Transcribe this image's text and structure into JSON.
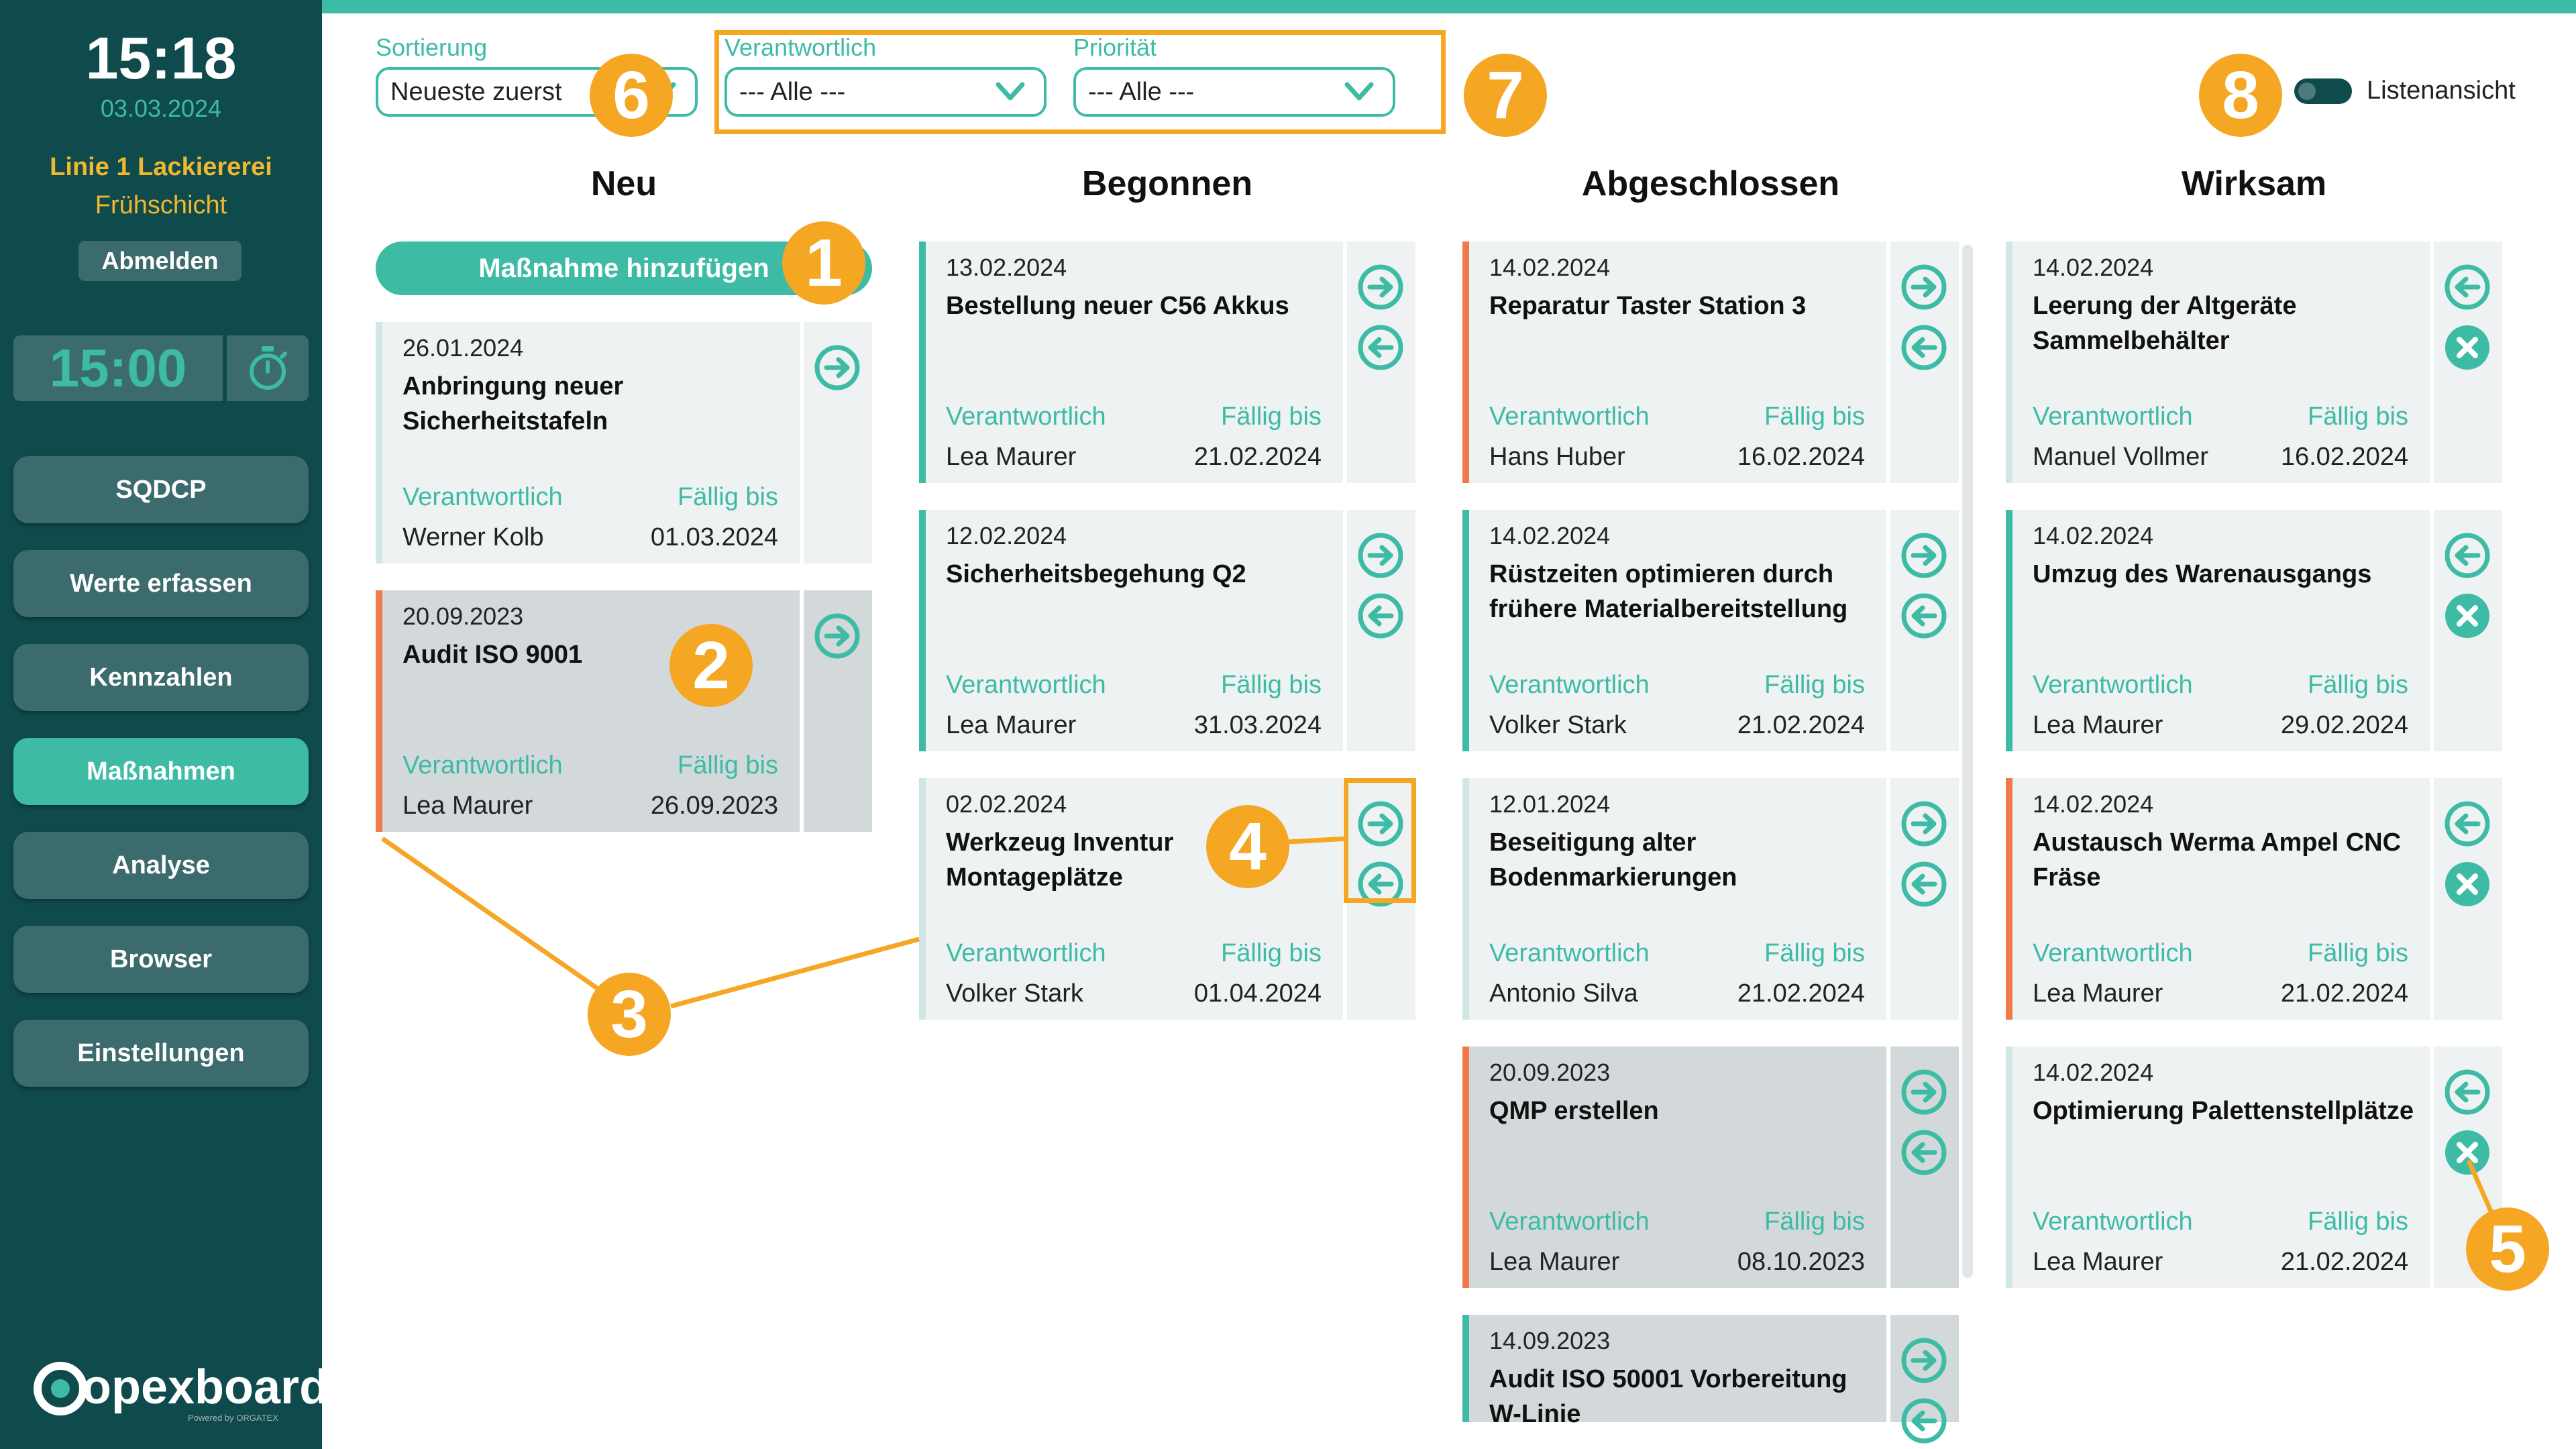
{
  "sidebar": {
    "time": "15:18",
    "date": "03.03.2024",
    "line": "Linie 1 Lackiererei",
    "shift": "Frühschicht",
    "logout_label": "Abmelden",
    "timer": "15:00",
    "nav": [
      "SQDCP",
      "Werte erfassen",
      "Kennzahlen",
      "Maßnahmen",
      "Analyse",
      "Browser",
      "Einstellungen"
    ],
    "active_nav": "Maßnahmen",
    "logo_text": "opexboard",
    "logo_sub": "Powered by ORGATEX"
  },
  "filters": {
    "sort_label": "Sortierung",
    "sort_value": "Neueste zuerst",
    "owner_label": "Verantwortlich",
    "owner_value": "--- Alle ---",
    "prio_label": "Priorität",
    "prio_value": "--- Alle ---",
    "list_view_label": "Listenansicht"
  },
  "columns": {
    "new": "Neu",
    "started": "Begonnen",
    "done": "Abgeschlossen",
    "effective": "Wirksam"
  },
  "add_button": "Maßnahme hinzufügen",
  "labels": {
    "owner": "Verantwortlich",
    "due": "Fällig bis"
  },
  "callouts": [
    "1",
    "2",
    "3",
    "4",
    "5",
    "6",
    "7",
    "8"
  ],
  "cards": {
    "new": [
      {
        "date": "26.01.2024",
        "title": "Anbringung neuer Sicherheitstafeln",
        "owner": "Werner Kolb",
        "due": "01.03.2024",
        "accent": "#cfe8e5"
      },
      {
        "date": "20.09.2023",
        "title": "Audit ISO 9001",
        "owner": "Lea Maurer",
        "due": "26.09.2023",
        "accent": "#f07a4a"
      }
    ],
    "started": [
      {
        "date": "13.02.2024",
        "title": "Bestellung neuer C56 Akkus",
        "owner": "Lea Maurer",
        "due": "21.02.2024",
        "accent": "#3dbba5"
      },
      {
        "date": "12.02.2024",
        "title": "Sicherheitsbegehung Q2",
        "owner": "Lea Maurer",
        "due": "31.03.2024",
        "accent": "#3dbba5"
      },
      {
        "date": "02.02.2024",
        "title": "Werkzeug Inventur Montageplätze",
        "owner": "Volker Stark",
        "due": "01.04.2024",
        "accent": "#cfe8e5"
      }
    ],
    "done": [
      {
        "date": "14.02.2024",
        "title": "Reparatur Taster Station 3",
        "owner": "Hans Huber",
        "due": "16.02.2024",
        "accent": "#f07a4a"
      },
      {
        "date": "14.02.2024",
        "title": "Rüstzeiten optimieren durch frühere Materialbereitstellung",
        "owner": "Volker Stark",
        "due": "21.02.2024",
        "accent": "#3dbba5"
      },
      {
        "date": "12.01.2024",
        "title": "Beseitigung alter Bodenmarkierungen",
        "owner": "Antonio Silva",
        "due": "21.02.2024",
        "accent": "#cfe8e5"
      },
      {
        "date": "20.09.2023",
        "title": "QMP erstellen",
        "owner": "Lea Maurer",
        "due": "08.10.2023",
        "accent": "#f07a4a"
      },
      {
        "date": "14.09.2023",
        "title": "Audit ISO 50001 Vorbereitung W-Linie",
        "owner": "",
        "due": "",
        "accent": "#3dbba5"
      }
    ],
    "effective": [
      {
        "date": "14.02.2024",
        "title": "Leerung der Altgeräte Sammelbehälter",
        "owner": "Manuel Vollmer",
        "due": "16.02.2024",
        "accent": "#cfe8e5"
      },
      {
        "date": "14.02.2024",
        "title": "Umzug des Warenausgangs",
        "owner": "Lea Maurer",
        "due": "29.02.2024",
        "accent": "#3dbba5"
      },
      {
        "date": "14.02.2024",
        "title": "Austausch Werma Ampel CNC Fräse",
        "owner": "Lea Maurer",
        "due": "21.02.2024",
        "accent": "#f07a4a"
      },
      {
        "date": "14.02.2024",
        "title": "Optimierung Palettenstellplätze",
        "owner": "Lea Maurer",
        "due": "21.02.2024",
        "accent": "#cfe8e5"
      }
    ]
  },
  "colors": {
    "teal": "#3dbba5",
    "sidebar": "#0f4a4c",
    "highlight": "#f5a623",
    "priority_high": "#f07a4a",
    "priority_mid": "#3dbba5",
    "priority_low": "#cfe8e5"
  }
}
